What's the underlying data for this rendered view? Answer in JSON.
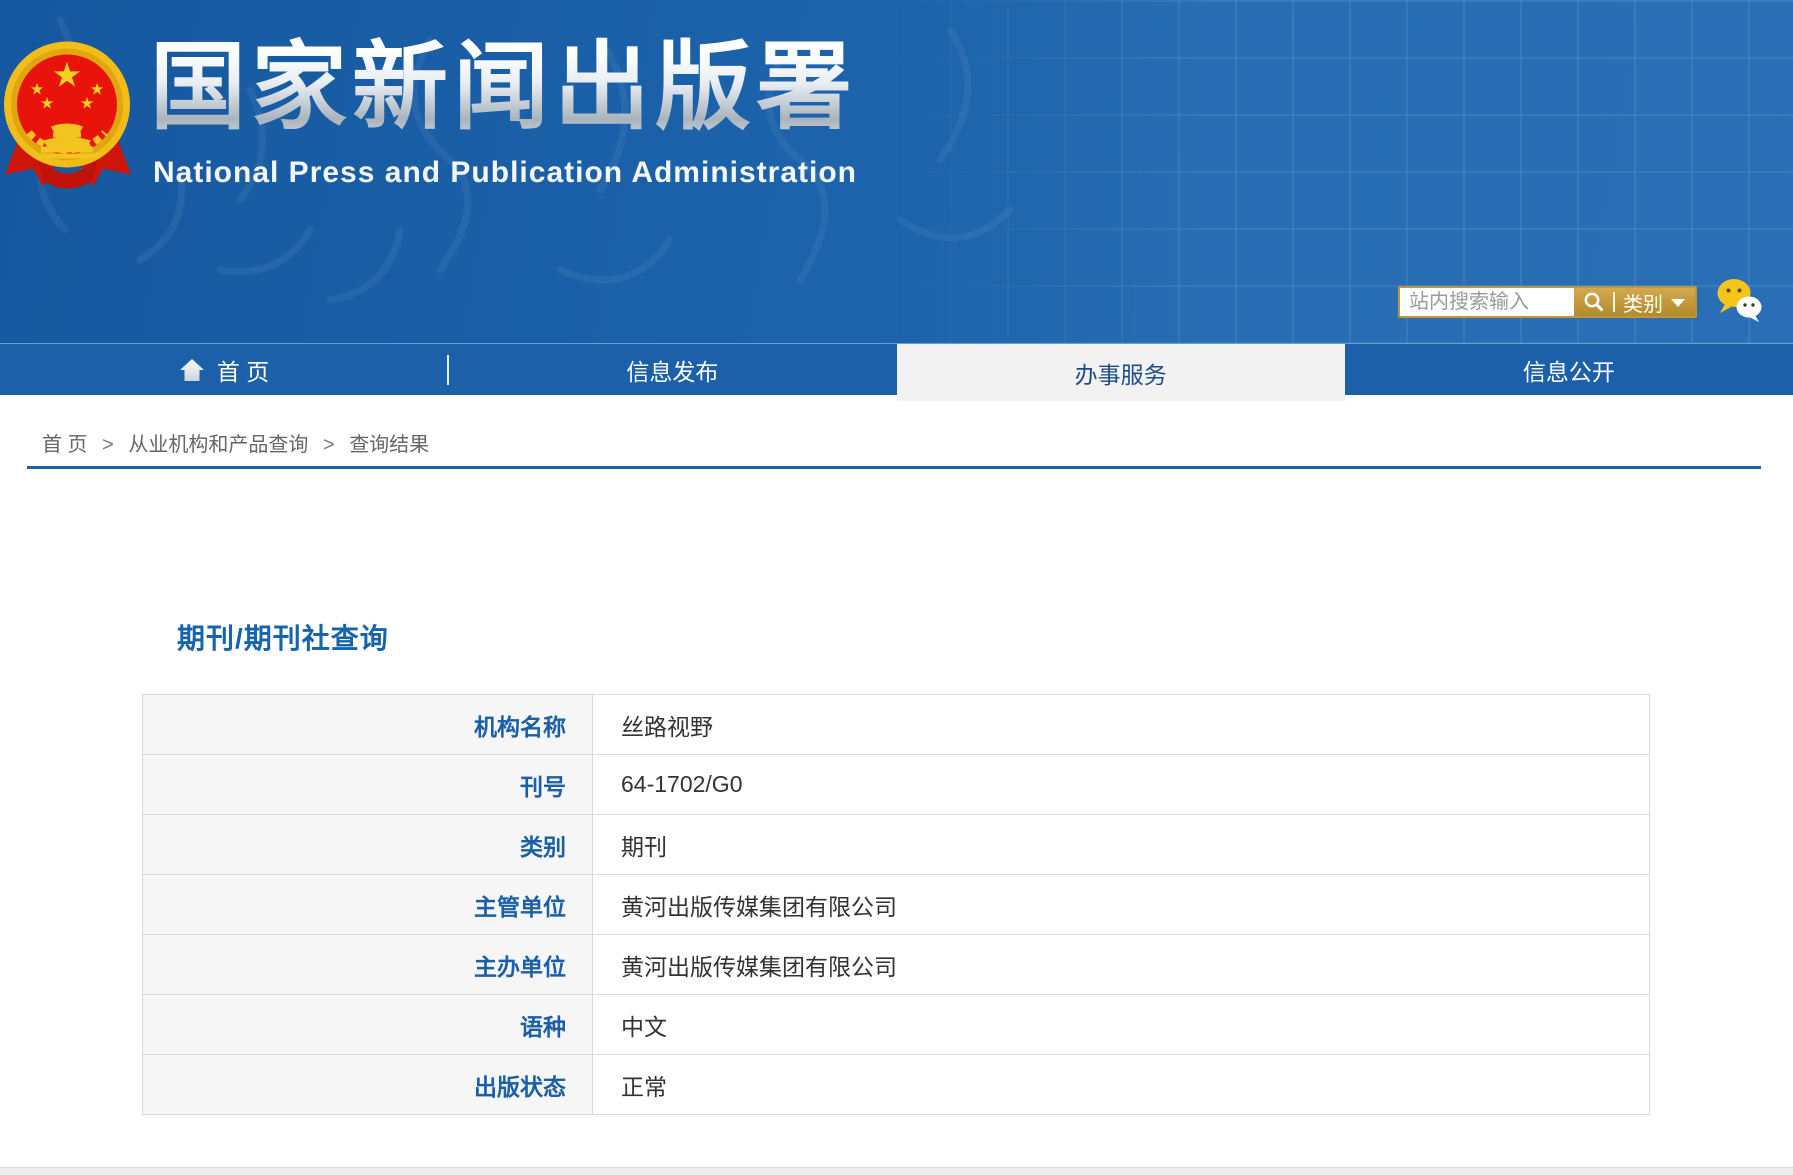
{
  "header": {
    "site_title": "国家新闻出版署",
    "site_subtitle": "National  Press and Publication Administration",
    "search": {
      "placeholder": "站内搜索输入",
      "category_label": "类别"
    }
  },
  "nav": {
    "items": [
      {
        "label": "首 页"
      },
      {
        "label": "信息发布"
      },
      {
        "label": "办事服务",
        "active": true
      },
      {
        "label": "信息公开"
      }
    ]
  },
  "breadcrumb": {
    "separator": ">",
    "items": [
      "首 页",
      "从业机构和产品查询",
      "查询结果"
    ]
  },
  "main": {
    "title": "期刊/期刊社查询",
    "table": {
      "rows": [
        {
          "label": "机构名称",
          "value": "丝路视野"
        },
        {
          "label": "刊号",
          "value": "64-1702/G0"
        },
        {
          "label": "类别",
          "value": "期刊"
        },
        {
          "label": "主管单位",
          "value": "黄河出版传媒集团有限公司"
        },
        {
          "label": "主办单位",
          "value": "黄河出版传媒集团有限公司"
        },
        {
          "label": "语种",
          "value": "中文"
        },
        {
          "label": "出版状态",
          "value": "正常"
        }
      ]
    }
  },
  "colors": {
    "header_blue": "#1c63ab",
    "nav_blue": "#1b60a8",
    "accent_blue": "#1a5fa8",
    "gold": "#c1983a",
    "emblem_red": "#e1180c",
    "active_tab_bg": "#f2f2f2"
  }
}
